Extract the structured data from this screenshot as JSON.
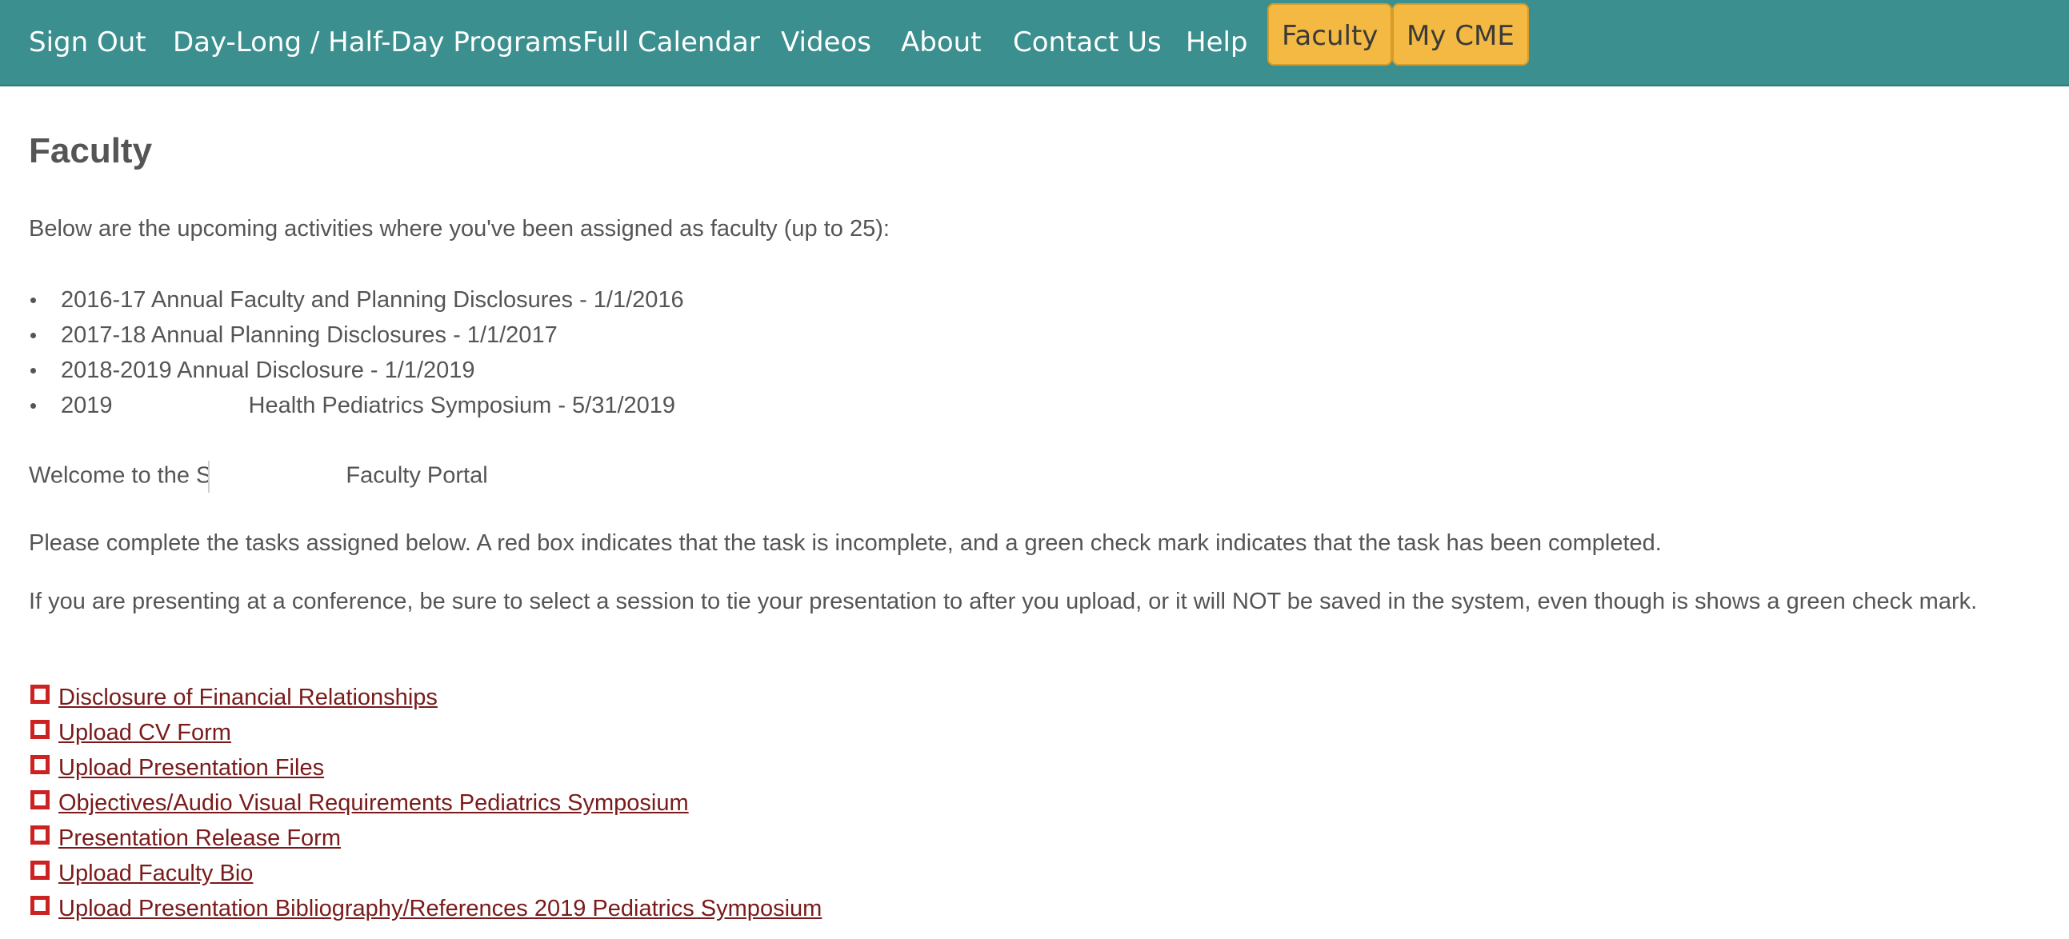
{
  "nav": {
    "items": [
      {
        "label": "Sign Out"
      },
      {
        "label": "Day-Long / Half-Day Programs"
      },
      {
        "label": "Full Calendar"
      },
      {
        "label": "Videos"
      },
      {
        "label": "About"
      },
      {
        "label": "Contact Us"
      },
      {
        "label": "Help"
      },
      {
        "label": "Faculty"
      },
      {
        "label": "My CME"
      }
    ],
    "bar_color": "#3b8f8f",
    "pill_color": "#f4b942"
  },
  "page": {
    "title": "Faculty",
    "intro": "Below are the upcoming activities where you've been assigned as faculty (up to 25):",
    "activities": [
      {
        "text": "2016-17 Annual Faculty and Planning Disclosures - 1/1/2016"
      },
      {
        "text": "2017-18 Annual Planning Disclosures - 1/1/2017"
      },
      {
        "text": "2018-2019 Annual Disclosure - 1/1/2019"
      },
      {
        "text_prefix": "2019",
        "text_suffix": "Health Pediatrics Symposium - 5/31/2019"
      }
    ],
    "welcome_prefix": "Welcome to the S",
    "welcome_suffix": "Faculty Portal",
    "instructions": "Please complete the tasks assigned below. A red box indicates that the task is incomplete, and a green check mark indicates that the task has been completed.",
    "warning": "If you are presenting at a conference, be sure to select a session to tie your presentation to after you upload, or it will NOT be saved in the system, even though is shows a green check mark."
  },
  "tasks": [
    {
      "label": "Disclosure of Financial Relationships",
      "status": "incomplete"
    },
    {
      "label": "Upload CV Form",
      "status": "incomplete"
    },
    {
      "label": "Upload Presentation Files",
      "status": "incomplete"
    },
    {
      "label": "Objectives/Audio Visual Requirements Pediatrics Symposium",
      "status": "incomplete"
    },
    {
      "label": "Presentation Release Form",
      "status": "incomplete"
    },
    {
      "label": "Upload Faculty Bio",
      "status": "incomplete"
    },
    {
      "label": "Upload Presentation Bibliography/References 2019 Pediatrics Symposium",
      "status": "incomplete"
    }
  ],
  "colors": {
    "incomplete_box": "#cc2222",
    "link": "#7a1a1a",
    "text": "#555555"
  }
}
